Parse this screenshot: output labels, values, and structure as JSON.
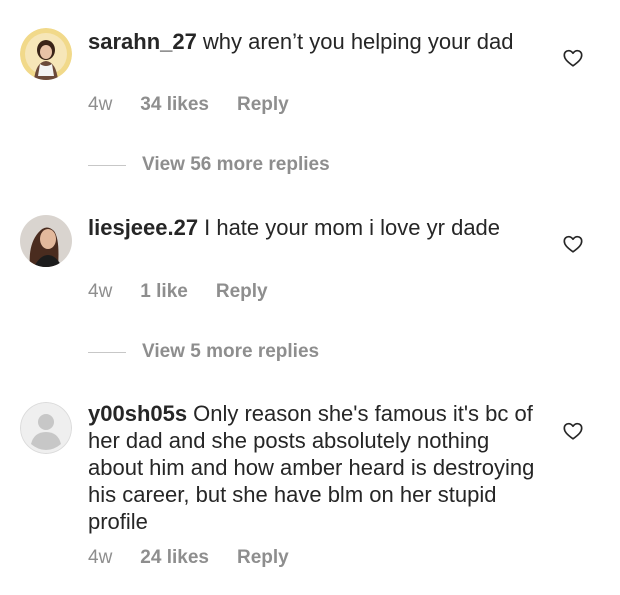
{
  "comments": [
    {
      "username": "sarahn_27",
      "text": "why aren’t you helping your dad",
      "time": "4w",
      "likes": "34 likes",
      "reply": "Reply",
      "view_replies": "View 56 more replies",
      "avatar": "profile-photo",
      "liked": false
    },
    {
      "username": "liesjeee.27",
      "text": "I hate your mom i love yr dade",
      "time": "4w",
      "likes": "1 like",
      "reply": "Reply",
      "view_replies": "View 5 more replies",
      "avatar": "profile-photo",
      "liked": false
    },
    {
      "username": "y00sh05s",
      "text": "Only reason she's famous it's bc of her dad and she posts absolutely nothing about him and how amber heard is destroying his career,  but she have blm on her stupid profile",
      "time": "4w",
      "likes": "24 likes",
      "reply": "Reply",
      "avatar": "default-avatar",
      "liked": false
    }
  ],
  "colors": {
    "text": "#262626",
    "secondary": "#8e8e8e",
    "divider": "#c7c7c7"
  },
  "icons": [
    "heart-icon",
    "default-avatar-icon"
  ]
}
